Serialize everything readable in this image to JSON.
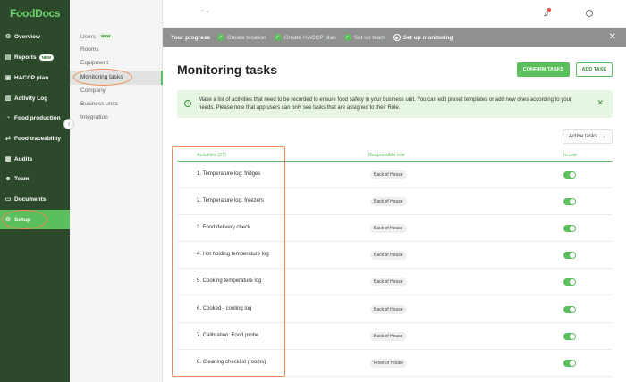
{
  "app": {
    "logo": "FoodDocs"
  },
  "nav": {
    "items": [
      {
        "label": "Overview",
        "icon": "gear-icon",
        "glyph": "⚙"
      },
      {
        "label": "Reports",
        "icon": "chart-icon",
        "glyph": "▤",
        "badge": "NEW"
      },
      {
        "label": "HACCP plan",
        "icon": "document-icon",
        "glyph": "▣"
      },
      {
        "label": "Activity Log",
        "icon": "chart-icon",
        "glyph": "▥"
      },
      {
        "label": "Food production",
        "icon": "pot-icon",
        "glyph": "◔"
      },
      {
        "label": "Food traceability",
        "icon": "route-icon",
        "glyph": "⇄"
      },
      {
        "label": "Audits",
        "icon": "clipboard-icon",
        "glyph": "▦"
      },
      {
        "label": "Team",
        "icon": "team-icon",
        "glyph": "☻"
      },
      {
        "label": "Documents",
        "icon": "folder-icon",
        "glyph": "▭"
      },
      {
        "label": "Setup",
        "icon": "gear-icon",
        "glyph": "⚙"
      }
    ]
  },
  "subnav": {
    "items": [
      {
        "label": "Users",
        "badge": "NEW"
      },
      {
        "label": "Rooms"
      },
      {
        "label": "Equipment"
      },
      {
        "label": "Monitoring tasks"
      },
      {
        "label": "Company"
      },
      {
        "label": "Business units"
      },
      {
        "label": "Integration"
      }
    ]
  },
  "topbar": {
    "select": "-  ⌄"
  },
  "progress": {
    "label": "Your progress",
    "steps": [
      "Create location",
      "Create HACCP plan",
      "Set up team",
      "Set up monitoring"
    ]
  },
  "page": {
    "title": "Monitoring tasks",
    "confirm_label": "CONFIRM TASKS",
    "add_label": "ADD TASK"
  },
  "banner": {
    "text": "Make a list of activities that need to be recorded to ensure food safety in your business unit. You can edit preset templates or add new ones according to your needs. Please note that app users can only see tasks that are assigned to their Role."
  },
  "filter": {
    "value": "Active tasks"
  },
  "table": {
    "headers": {
      "activities": "Activities (27)",
      "role": "Responsible role",
      "in_use": "In use"
    },
    "rows": [
      {
        "name": "1. Temperature log: fridges",
        "role": "Back of House",
        "in_use": true
      },
      {
        "name": "2. Temperature log: freezers",
        "role": "Back of House",
        "in_use": true
      },
      {
        "name": "3. Food delivery check",
        "role": "Back of House",
        "in_use": true
      },
      {
        "name": "4. Hot holding temperature log",
        "role": "Back of House",
        "in_use": true
      },
      {
        "name": "5. Cooking temperature log",
        "role": "Back of House",
        "in_use": true
      },
      {
        "name": "6. Cooked - cooling log",
        "role": "Back of House",
        "in_use": true
      },
      {
        "name": "7. Calibration: Food probe",
        "role": "Back of House",
        "in_use": true
      },
      {
        "name": "8. Cleaning checklist (rooms)",
        "role": "Front of House",
        "in_use": true
      }
    ]
  },
  "colors": {
    "brand": "#5abf5c",
    "nav_bg": "#2c4a2b",
    "annotation": "#ef8a55"
  }
}
